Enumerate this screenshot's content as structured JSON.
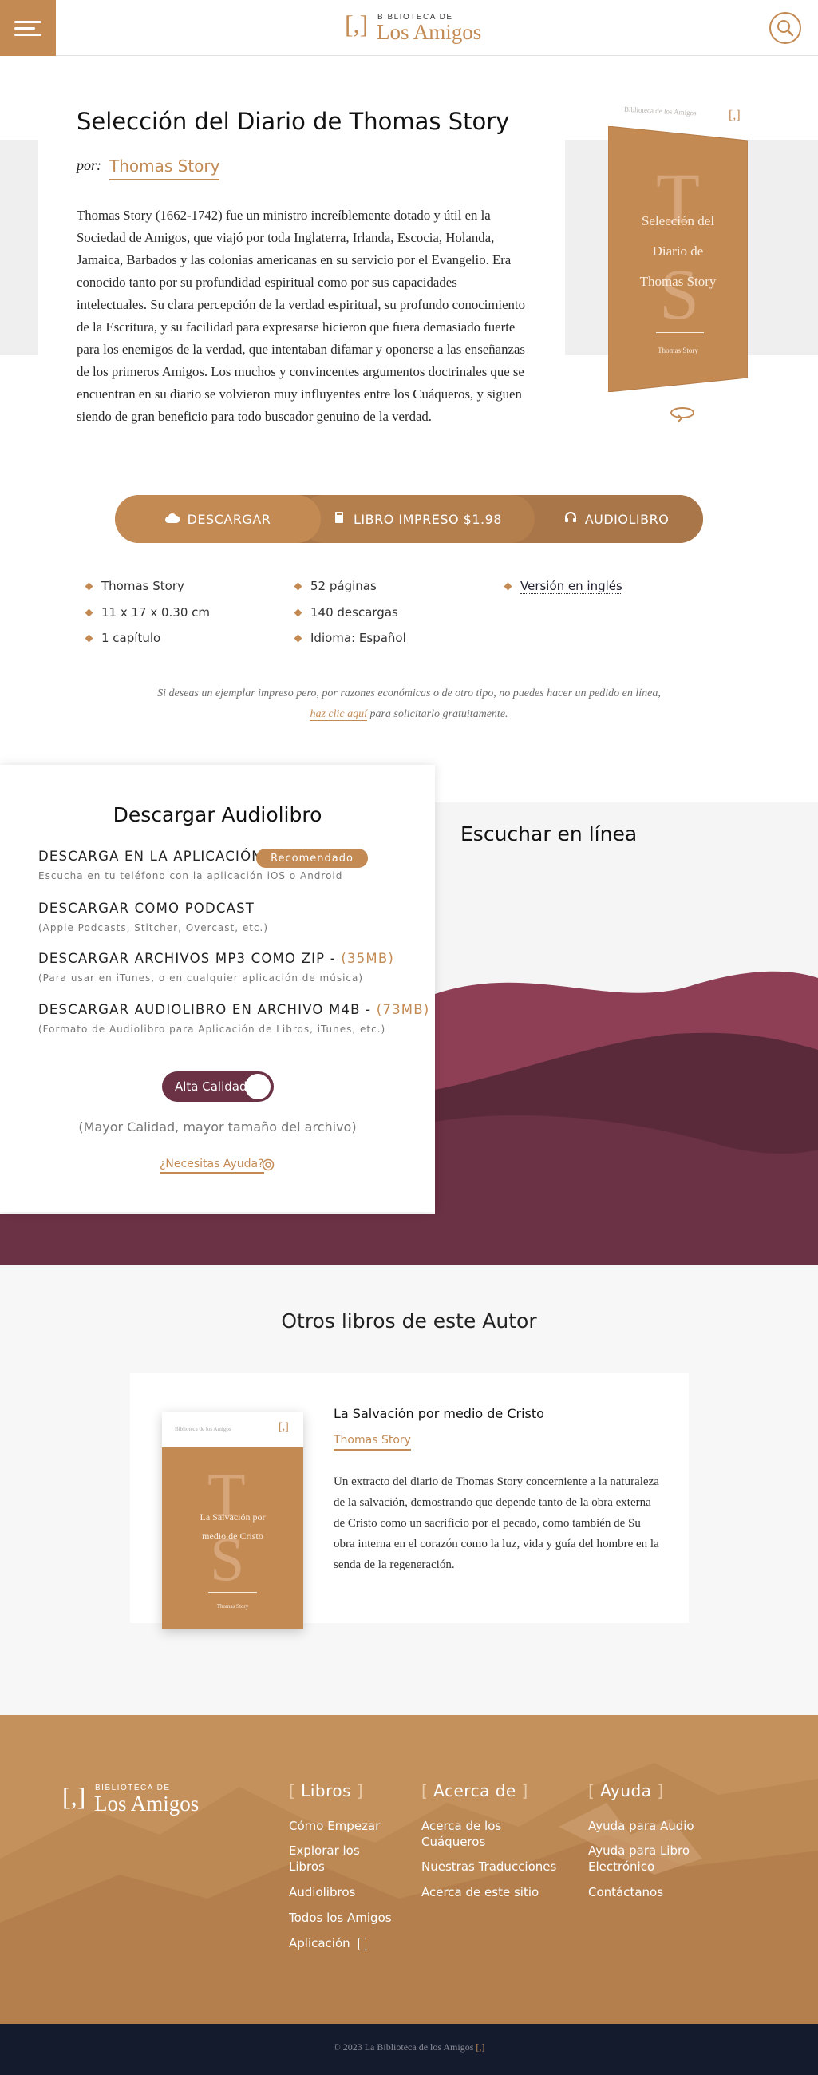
{
  "header": {
    "logo_top": "BIBLIOTECA DE",
    "logo_main": "Los Amigos",
    "logo_mark": "[,]",
    "menu_icon": "hamburger-icon",
    "search_icon": "search-icon"
  },
  "book": {
    "title": "Selección del Diario de Thomas Story",
    "by_label": "por:",
    "author": "Thomas Story",
    "description": "Thomas Story (1662-1742) fue un ministro increíblemente dotado y útil en la Sociedad de Amigos, que viajó por toda Inglaterra, Irlanda, Escocia, Holanda, Jamaica, Barbados y las colonias americanas en su servicio por el Evangelio. Era conocido tanto por su profundidad espiritual como por sus capacidades intelectuales. Su clara percepción de la verdad espiritual, su profundo conocimiento de la Escritura, y su facilidad para expresarse hicieron que fuera demasiado fuerte para los enemigos de la verdad, que intentaban difamar y oponerse a las enseñanzas de los primeros Amigos. Los muchos y convincentes argumentos doctrinales que se encuentran en su diario se volvieron muy influyentes entre los Cuáqueros, y siguen siendo de gran beneficio para todo buscador genuino de la verdad."
  },
  "cover": {
    "top_small": "Biblioteca de los Amigos",
    "mark": "[,]",
    "big_letter_1": "T",
    "big_letter_2": "S",
    "title_line1": "Selección del",
    "title_line2": "Diario de",
    "title_line3": "Thomas Story",
    "author": "Thomas Story"
  },
  "actions": {
    "download": "DESCARGAR",
    "print": "LIBRO IMPRESO $1.98",
    "audiobook": "AUDIOLIBRO"
  },
  "meta": {
    "col1": [
      "Thomas Story",
      "11 x 17 x 0.30 cm",
      "1 capítulo"
    ],
    "col2": [
      "52 páginas",
      "140 descargas",
      "Idioma: Español"
    ],
    "col3": [
      "Versión en inglés"
    ]
  },
  "print_note": {
    "text_before": "Si deseas un ejemplar impreso pero, por razones económicas o de otro tipo, no puedes hacer un pedido en línea,",
    "link": "haz clic aquí",
    "text_after": "para solicitarlo gratuitamente."
  },
  "audio": {
    "title": "Descargar Audiolibro",
    "items": [
      {
        "label": "DESCARGA EN LA APLICACIÓN",
        "sub": "Escucha en tu teléfono con la aplicación iOS o Android",
        "size": ""
      },
      {
        "label": "DESCARGAR COMO PODCAST",
        "sub": "(Apple Podcasts, Stitcher, Overcast, etc.)",
        "size": ""
      },
      {
        "label": "DESCARGAR ARCHIVOS MP3 COMO ZIP - ",
        "sub": "(Para usar en iTunes, o en cualquier aplicación de música)",
        "size": "(35MB)"
      },
      {
        "label": "DESCARGAR AUDIOLIBRO EN ARCHIVO M4B - ",
        "sub": "(Formato de Audiolibro para Aplicación de Libros, iTunes, etc.)",
        "size": "(73MB)"
      }
    ],
    "recommended": "Recomendado",
    "quality_toggle": "Alta Calidad",
    "quality_note": "(Mayor Calidad, mayor tamaño del archivo)",
    "help": "¿Necesitas Ayuda?",
    "listen_title": "Escuchar en línea",
    "wave_colors": [
      "#8e3f55",
      "#5b2a3a",
      "#6b3145"
    ]
  },
  "others": {
    "title": "Otros libros de este Autor",
    "book_title": "La Salvación por medio de Cristo",
    "book_author": "Thomas Story",
    "book_desc": "Un extracto del diario de Thomas Story concerniente a la naturaleza de la salvación, demostrando que depende tanto de la obra externa de Cristo como un sacrificio por el pecado, como también de Su obra interna en el corazón como la luz, vida y guía del hombre en la senda de la regeneración.",
    "cover_small": "Biblioteca de los Amigos",
    "cover_mark": "[,]",
    "cover_title_1": "La Salvación por",
    "cover_title_2": "medio de Cristo",
    "cover_author": "Thomas Story"
  },
  "footer": {
    "logo_top": "BIBLIOTECA DE",
    "logo_main": "Los Amigos",
    "logo_mark": "[,]",
    "col1_title": "Libros",
    "col1_links": [
      "Cómo Empezar",
      "Explorar los Libros",
      "Audiolibros",
      "Todos los Amigos",
      "Aplicación"
    ],
    "col2_title": "Acerca de",
    "col2_links": [
      "Acerca de los Cuáqueros",
      "Nuestras Traducciones",
      "Acerca de este sitio"
    ],
    "col3_title": "Ayuda",
    "col3_links": [
      "Ayuda para Audio",
      "Ayuda para Libro Electrónico",
      "Contáctanos"
    ],
    "copyright": "© 2023 La Biblioteca de los Amigos",
    "copyright_mark": "[,]"
  },
  "colors": {
    "accent": "#c38a54",
    "wine": "#6b3145",
    "navy": "#141b2d"
  }
}
